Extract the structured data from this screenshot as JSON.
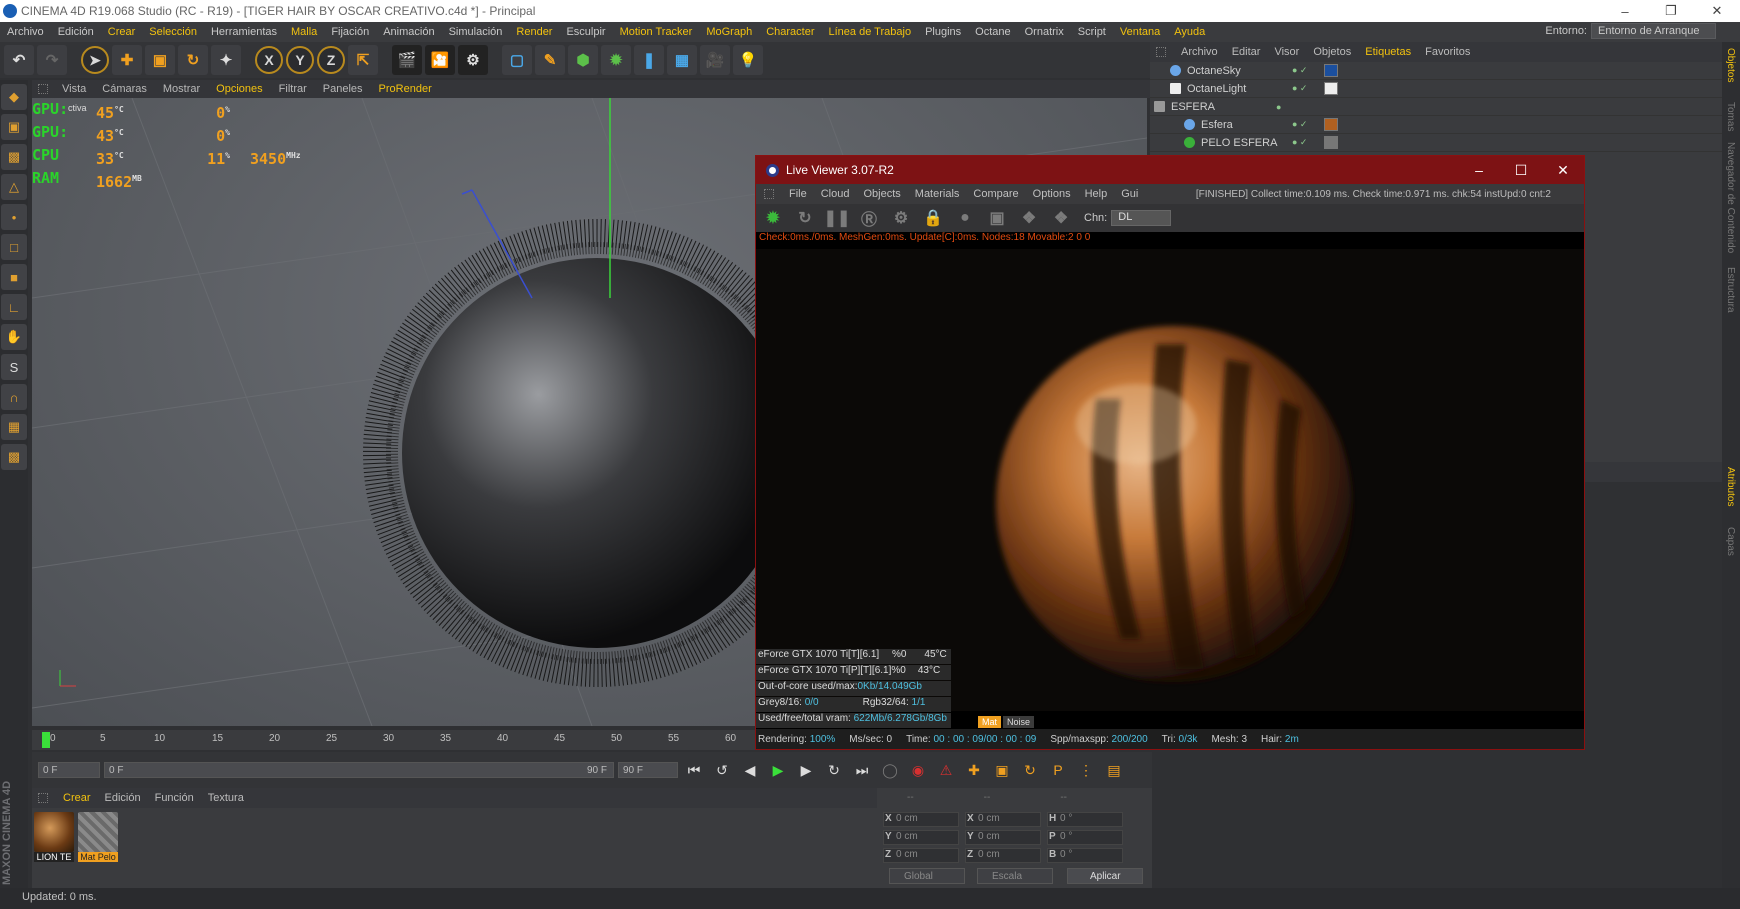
{
  "window": {
    "title": "CINEMA 4D R19.068 Studio (RC - R19) - [TIGER HAIR BY OSCAR CREATIVO.c4d *] - Principal"
  },
  "menubar": {
    "items": [
      {
        "label": "Archivo",
        "highlight": false
      },
      {
        "label": "Edición",
        "highlight": false
      },
      {
        "label": "Crear",
        "highlight": true
      },
      {
        "label": "Selección",
        "highlight": true
      },
      {
        "label": "Herramientas",
        "highlight": false
      },
      {
        "label": "Malla",
        "highlight": true
      },
      {
        "label": "Fijación",
        "highlight": false
      },
      {
        "label": "Animación",
        "highlight": false
      },
      {
        "label": "Simulación",
        "highlight": false
      },
      {
        "label": "Render",
        "highlight": true
      },
      {
        "label": "Esculpir",
        "highlight": false
      },
      {
        "label": "Motion Tracker",
        "highlight": true
      },
      {
        "label": "MoGraph",
        "highlight": true
      },
      {
        "label": "Character",
        "highlight": true
      },
      {
        "label": "Línea de Trabajo",
        "highlight": true
      },
      {
        "label": "Plugins",
        "highlight": false
      },
      {
        "label": "Octane",
        "highlight": false
      },
      {
        "label": "Ornatrix",
        "highlight": false
      },
      {
        "label": "Script",
        "highlight": false
      },
      {
        "label": "Ventana",
        "highlight": true
      },
      {
        "label": "Ayuda",
        "highlight": true
      }
    ],
    "env_label": "Entorno:",
    "env_value": "Entorno de Arranque"
  },
  "viewport": {
    "menu": [
      "Vista",
      "Cámaras",
      "Mostrar",
      "Opciones",
      "Filtrar",
      "Paneles",
      "ProRender"
    ],
    "label": "ctiva",
    "hud": {
      "gpu1": {
        "label": "GPU:",
        "temp": "45",
        "load": "0"
      },
      "gpu2": {
        "label": "GPU:",
        "temp": "43",
        "load": "0"
      },
      "cpu": {
        "label": "CPU",
        "temp": "33",
        "load": "11",
        "freq": "3450"
      },
      "ram": {
        "label": "RAM",
        "value": "1662"
      },
      "unit_c": "°C",
      "unit_pct": "%",
      "unit_mhz": "MHz",
      "unit_mb": "MB"
    }
  },
  "liveviewer": {
    "title": "Live Viewer 3.07-R2",
    "menu": [
      "File",
      "Cloud",
      "Objects",
      "Materials",
      "Compare",
      "Options",
      "Help",
      "Gui"
    ],
    "status": "[FINISHED] Collect time:0.109 ms.  Check time:0.971 ms.  chk:54  instUpd:0  cnt:2",
    "chn_label": "Chn:",
    "chn_value": "DL",
    "debug": "Check:0ms./0ms. MeshGen:0ms. Update[C]:0ms. Nodes:18 Movable:2  0 0",
    "stats": {
      "gpu1_name": "eForce GTX 1070 Ti[T][6.1]",
      "gpu1_pct": "%0",
      "gpu1_temp": "45°C",
      "gpu2_name": "eForce GTX 1070 Ti[P][T][6.1]%0",
      "gpu2_temp": "43°C",
      "ooc_label": "Out-of-core used/max:",
      "ooc_value": "0Kb/14.049Gb",
      "grey_label": "Grey8/16:",
      "grey_value": "0/0",
      "rgb_label": "Rgb32/64:",
      "rgb_value": "1/1",
      "vram_label": "Used/free/total vram:",
      "vram_value": "622Mb/6.278Gb/8Gb"
    },
    "tags": {
      "mat": "Mat",
      "noise": "Noise"
    },
    "bottom": {
      "rendering_label": "Rendering:",
      "rendering_value": "100%",
      "mssec": "Ms/sec: 0",
      "time_label": "Time:",
      "time_value": "00 : 00 : 09/00 : 00 : 09",
      "spp_label": "Spp/maxspp:",
      "spp_value": "200/200",
      "tri_label": "Tri:",
      "tri_value": "0/3k",
      "mesh": "Mesh: 3",
      "hair_label": "Hair:",
      "hair_value": "2m"
    }
  },
  "objects": {
    "menu": [
      "Archivo",
      "Editar",
      "Visor",
      "Objetos",
      "Etiquetas",
      "Favoritos"
    ],
    "items": [
      {
        "name": "OctaneSky",
        "indent": 0
      },
      {
        "name": "OctaneLight",
        "indent": 0
      },
      {
        "name": "ESFERA",
        "indent": 0
      },
      {
        "name": "Esfera",
        "indent": 1
      },
      {
        "name": "PELO ESFERA",
        "indent": 1
      }
    ]
  },
  "right_tabs": [
    "Objetos",
    "Tomas",
    "Navegador de Contenido",
    "Estructura",
    "Atributos",
    "Capas"
  ],
  "timeline": {
    "ticks": [
      "0",
      "5",
      "10",
      "15",
      "20",
      "25",
      "30",
      "35",
      "40",
      "45",
      "50",
      "55",
      "60"
    ],
    "current": "0 F",
    "start_field": "0 F",
    "end_field": "90 F",
    "range_end": "90 F"
  },
  "materials": {
    "menu": [
      "Crear",
      "Edición",
      "Función",
      "Textura"
    ],
    "items": [
      {
        "name": "LION TE",
        "selected": false
      },
      {
        "name": "Mat Pelo",
        "selected": true
      }
    ]
  },
  "coordinates": {
    "rows": [
      {
        "a": "X",
        "av": "0 cm",
        "b": "X",
        "bv": "0 cm",
        "c": "H",
        "cv": "0 °"
      },
      {
        "a": "Y",
        "av": "0 cm",
        "b": "Y",
        "bv": "0 cm",
        "c": "P",
        "cv": "0 °"
      },
      {
        "a": "Z",
        "av": "0 cm",
        "b": "Z",
        "bv": "0 cm",
        "c": "B",
        "cv": "0 °"
      }
    ],
    "mode1": "Global",
    "mode2": "Escala",
    "apply": "Aplicar"
  },
  "status": {
    "text": "Updated: 0 ms."
  },
  "branding": {
    "text": "MAXON CINEMA 4D"
  },
  "colors": {
    "accent": "#f2c20f",
    "lv_titlebar": "#7d1214",
    "hud_green": "#2ad42a",
    "hud_orange": "#f0a020"
  }
}
